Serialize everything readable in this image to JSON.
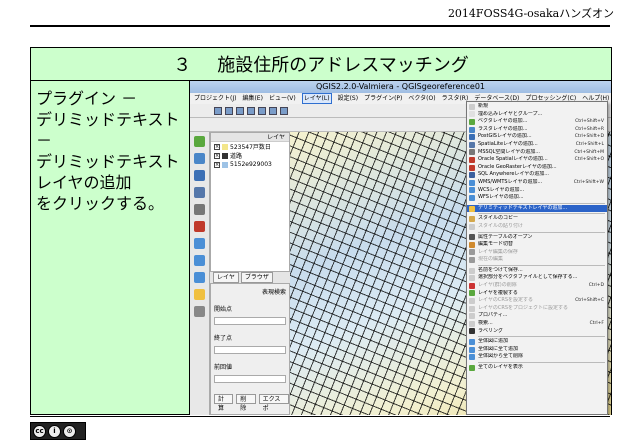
{
  "header": {
    "text": "2014FOSS4G-osakaハンズオン"
  },
  "title": {
    "number": "３",
    "text": "施設住所のアドレスマッチング"
  },
  "instruction": {
    "lines": [
      "プラグイン －",
      "デリミッドテキスト －",
      "デリミッドテキストレイヤの追加",
      "をクリックする。"
    ]
  },
  "qgis": {
    "window_title": "QGIS2.2.0-Valmiera - QGISgeoreference01",
    "menubar": [
      "プロジェクト(J)",
      "編集(E)",
      "ビュー(V)",
      "レイヤ(L)",
      "設定(S)",
      "プラグイン(P)",
      "ベクタ(O)",
      "ラスタ(R)",
      "データベース(D)",
      "プロセッシング(C)",
      "ヘルプ(H)"
    ],
    "active_menu_index": 3,
    "layers_panel_title": "レイヤ",
    "layers": [
      {
        "name": "523547戸数日",
        "color": "#f3e68a"
      },
      {
        "name": "道路",
        "color": "#333333"
      },
      {
        "name": "5152e929003",
        "color": "#9ec3e6"
      }
    ],
    "panel_tabs": [
      "レイヤ",
      "ブラウザ"
    ],
    "attribute_panel": {
      "title": "表現検索",
      "fields": [
        "開始点",
        "終了点",
        "前回値"
      ],
      "buttons": [
        "計算",
        "削除",
        "エクスポ"
      ]
    },
    "layer_menu": [
      {
        "label": "新規",
        "shortcut": "",
        "icon_color": "#cccccc",
        "state": "normal"
      },
      {
        "label": "埋め込みレイヤとグループ...",
        "shortcut": "",
        "icon_color": "#e0e0e0",
        "state": "normal"
      },
      {
        "label": "ベクタレイヤの追加...",
        "shortcut": "Ctrl+Shift+V",
        "icon_color": "#5aa83e",
        "state": "normal"
      },
      {
        "label": "ラスタレイヤの追加...",
        "shortcut": "Ctrl+Shift+R",
        "icon_color": "#4a86c8",
        "state": "normal"
      },
      {
        "label": "PostGISレイヤの追加...",
        "shortcut": "Ctrl+Shift+D",
        "icon_color": "#3b6fb5",
        "state": "normal"
      },
      {
        "label": "SpatiaLiteレイヤの追加...",
        "shortcut": "Ctrl+Shift+L",
        "icon_color": "#5577aa",
        "state": "normal"
      },
      {
        "label": "MSSQL空間レイヤの追加...",
        "shortcut": "Ctrl+Shift+M",
        "icon_color": "#777777",
        "state": "normal"
      },
      {
        "label": "Oracle Spatialレイヤの追加...",
        "shortcut": "Ctrl+Shift+O",
        "icon_color": "#c0392b",
        "state": "normal"
      },
      {
        "label": "Oracle GeoRasterレイヤの追加...",
        "shortcut": "",
        "icon_color": "#c0392b",
        "state": "normal"
      },
      {
        "label": "SQL Anywhereレイヤの追加...",
        "shortcut": "",
        "icon_color": "#3a5f9e",
        "state": "normal"
      },
      {
        "label": "WMS/WMTSレイヤの追加...",
        "shortcut": "Ctrl+Shift+W",
        "icon_color": "#4b8fd6",
        "state": "normal"
      },
      {
        "label": "WCSレイヤの追加...",
        "shortcut": "",
        "icon_color": "#4b8fd6",
        "state": "normal"
      },
      {
        "label": "WFSレイヤの追加...",
        "shortcut": "",
        "icon_color": "#4b8fd6",
        "state": "normal"
      },
      {
        "label": "デリミティッドテキストレイヤの追加...",
        "shortcut": "",
        "icon_color": "#f0c040",
        "state": "highlighted",
        "sep_before": true
      },
      {
        "label": "スタイルのコピー",
        "shortcut": "",
        "icon_color": "#d4a84c",
        "state": "normal",
        "sep_before": true
      },
      {
        "label": "スタイルの貼り付け",
        "shortcut": "",
        "icon_color": "#cccccc",
        "state": "disabled"
      },
      {
        "label": "属性テーブルのオープン",
        "shortcut": "",
        "icon_color": "#555555",
        "state": "normal",
        "sep_before": true
      },
      {
        "label": "編集モード切替",
        "shortcut": "",
        "icon_color": "#d08a2e",
        "state": "normal"
      },
      {
        "label": "レイヤ編集の保存",
        "shortcut": "",
        "icon_color": "#999999",
        "state": "disabled"
      },
      {
        "label": "現在の編集",
        "shortcut": "",
        "icon_color": "#999999",
        "state": "disabled"
      },
      {
        "label": "名前をつけて保存...",
        "shortcut": "",
        "icon_color": "#cccccc",
        "state": "normal",
        "sep_before": true
      },
      {
        "label": "選択部分をベクタファイルとして保存する...",
        "shortcut": "",
        "icon_color": "#cccccc",
        "state": "normal"
      },
      {
        "label": "レイヤ(群)の削除",
        "shortcut": "Ctrl+D",
        "icon_color": "#cc3333",
        "state": "disabled"
      },
      {
        "label": "レイヤを複製する",
        "shortcut": "",
        "icon_color": "#5aa83e",
        "state": "normal"
      },
      {
        "label": "レイヤのCRSを設定する",
        "shortcut": "Ctrl+Shift+C",
        "icon_color": "#cccccc",
        "state": "disabled"
      },
      {
        "label": "レイヤのCRSをプロジェクトに設定する",
        "shortcut": "",
        "icon_color": "#cccccc",
        "state": "disabled"
      },
      {
        "label": "プロパティ...",
        "shortcut": "",
        "icon_color": "#cccccc",
        "state": "normal"
      },
      {
        "label": "検索...",
        "shortcut": "Ctrl+F",
        "icon_color": "#cccccc",
        "state": "normal"
      },
      {
        "label": "ラベリング",
        "shortcut": "",
        "icon_color": "#333333",
        "state": "normal"
      },
      {
        "label": "全体図に追加",
        "shortcut": "",
        "icon_color": "#4b8fd6",
        "state": "normal",
        "sep_before": true
      },
      {
        "label": "全体図に全て追加",
        "shortcut": "",
        "icon_color": "#4b8fd6",
        "state": "normal"
      },
      {
        "label": "全体図から全て削除",
        "shortcut": "",
        "icon_color": "#4b8fd6",
        "state": "normal"
      },
      {
        "label": "全てのレイヤを表示",
        "shortcut": "",
        "icon_color": "#5aa83e",
        "state": "normal",
        "sep_before": true
      }
    ]
  },
  "footer": {
    "license_badge": "cc by sa",
    "license_glyphs": [
      "cc",
      "i",
      "⊙"
    ]
  },
  "colors": {
    "green_panel": "#ccffcc",
    "menu_highlight": "#2b63c8"
  }
}
